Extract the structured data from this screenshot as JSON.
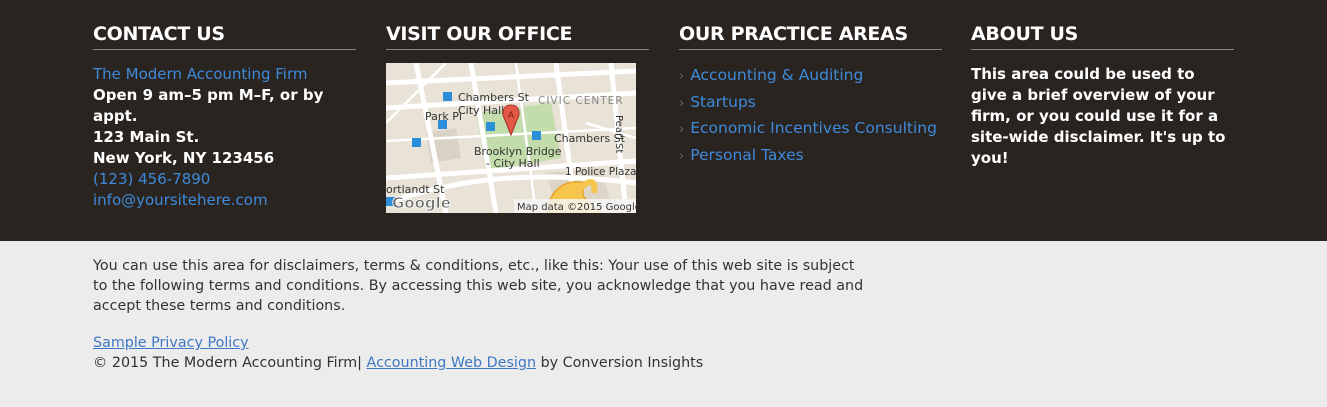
{
  "contact": {
    "heading": "CONTACT US",
    "firm": "The Modern Accounting Firm",
    "hours": "Open 9 am–5 pm M–F, or by appt.",
    "street": "123 Main St.",
    "city": "New York, NY 123456",
    "phone": "(123) 456-7890",
    "email": "info@yoursitehere.com"
  },
  "office": {
    "heading": "VISIT OUR OFFICE",
    "map": {
      "labels": [
        "Chambers St",
        "City Hall",
        "CIVIC CENTER",
        "Park Pl",
        "Chambers St",
        "Brooklyn Bridge",
        "- City Hall",
        "1 Police Plaza",
        "ortlandt St",
        "Pearl St"
      ],
      "marker": "A",
      "credit": "Map data ©2015 Google",
      "logo": "Google",
      "colors": {
        "land": "#e8e2d7",
        "park": "#c3dcab",
        "road": "#ffffff",
        "highway": "#f5c64b",
        "marker": "#e45848",
        "metro": "#2a8fd8"
      }
    }
  },
  "practice": {
    "heading": "OUR PRACTICE AREAS",
    "items": [
      "Accounting & Auditing",
      "Startups",
      "Economic Incentives Consulting",
      "Personal Taxes"
    ],
    "arrow": "›"
  },
  "about": {
    "heading": "ABOUT US",
    "text": "This area could be used to give a brief overview of your firm, or you could use it for a site-wide disclaimer. It's up to you!"
  },
  "footer": {
    "disclaimer": "You can use this area for disclaimers, terms & conditions, etc., like this: Your use of this web site is subject to the following terms and conditions. By accessing this web site, you acknowledge that you have read and accept these terms and conditions.",
    "privacy_link": "Sample Privacy Policy",
    "copyright": "© 2015 The Modern Accounting Firm|",
    "design_link": "Accounting Web Design",
    "by_text": "by Conversion Insights"
  },
  "colors": {
    "top_bg": "#2a2421",
    "bottom_bg": "#ececec",
    "link": "#3e8ad9",
    "heading": "#ffffff"
  }
}
